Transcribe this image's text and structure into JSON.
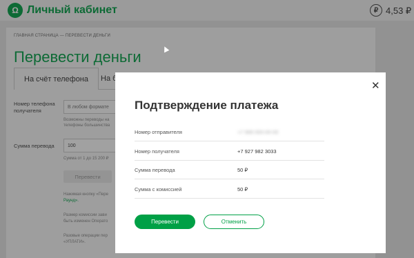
{
  "header": {
    "logo_glyph": "Ω",
    "brand": "Личный кабинет",
    "currency_glyph": "₽",
    "balance": "4,53 ₽",
    "accent": "#00a046"
  },
  "page": {
    "breadcrumb": "ГЛАВНАЯ СТРАНИЦА — ПЕРЕВЕСТИ ДЕНЬГИ",
    "title": "Перевести деньги",
    "tabs": [
      {
        "label": "На счёт телефона"
      },
      {
        "label": "На ба"
      }
    ],
    "form": {
      "phone_label": "Номер телефона получателя",
      "phone_placeholder": "В любом формате",
      "phone_hint": "Возможны переводы на телефоны большинства",
      "amount_label": "Сумма перевода",
      "amount_value": "100",
      "amount_hint": "Сумма от 1 до 15 200 ₽",
      "submit_label": "Перевести",
      "note1": "Нажимая кнопку «Пере",
      "note1b": "Раунд».",
      "note2": "Размер комиссии зави",
      "note2b": "быть изменен Операто",
      "note3": "Разовые операции пер",
      "note3b": "«УПЛАТИ»."
    }
  },
  "modal": {
    "title": "Подтверждение платежа",
    "rows": [
      {
        "label": "Номер отправителя",
        "value": "+7 999 000-00-00"
      },
      {
        "label": "Номер получателя",
        "value": "+7 927 982 3033"
      },
      {
        "label": "Сумма перевода",
        "value": "50 ₽"
      },
      {
        "label": "Сумма с комиссией",
        "value": "50 ₽"
      }
    ],
    "confirm_label": "Перевести",
    "cancel_label": "Отменить",
    "close_glyph": "✕"
  }
}
